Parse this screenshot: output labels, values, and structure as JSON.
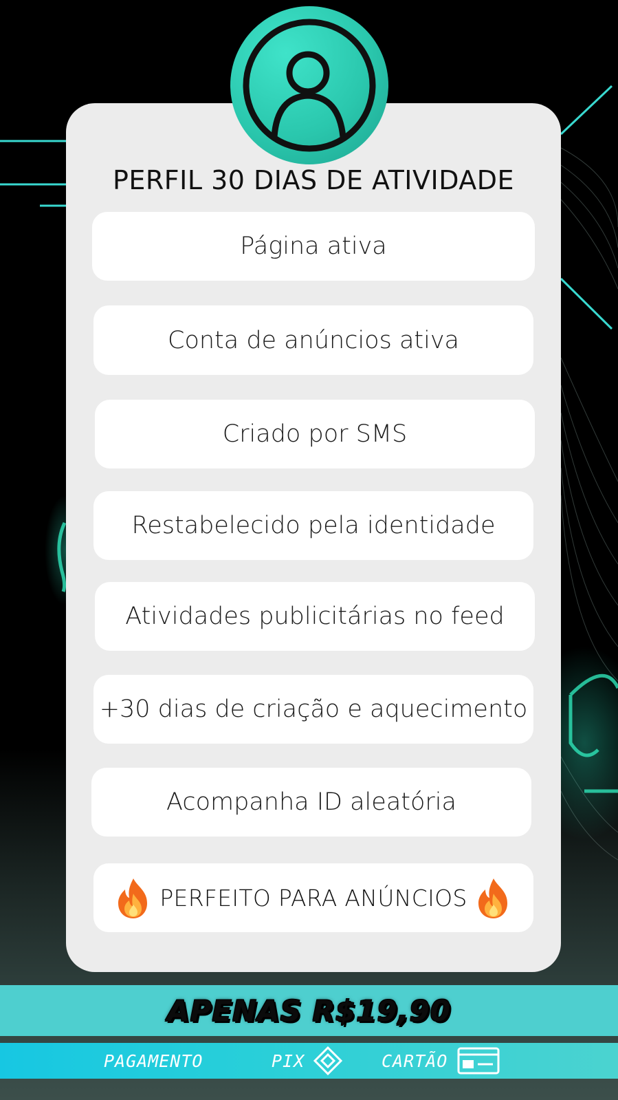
{
  "title": "PERFIL 30 DIAS DE ATIVIDADE",
  "features": [
    "Página ativa",
    "Conta de anúncios ativa",
    "Criado por SMS",
    "Restabelecido pela identidade",
    "Atividades publicitárias no feed",
    "+30 dias de criação e aquecimento",
    "Acompanha ID aleatória"
  ],
  "highlight": {
    "label": "PERFEITO PARA ANÚNCIOS",
    "icon_left": "fire-icon",
    "icon_right": "fire-icon"
  },
  "price": "APENAS R$19,90",
  "payment": {
    "label": "PAGAMENTO",
    "pix": "PIX",
    "pix_icon": "pix-icon",
    "card": "CARTÃO",
    "card_icon": "credit-card-icon"
  },
  "colors": {
    "accent": "#2ac7ad",
    "neon": "#3fe3d0",
    "card_bg": "#ececec",
    "price_band": "#4ecfcf",
    "pay_band": "#28cfd9"
  }
}
